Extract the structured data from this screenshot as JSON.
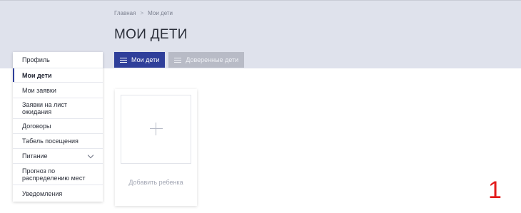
{
  "breadcrumb": {
    "home": "Главная",
    "separator": ">",
    "current": "Мои дети"
  },
  "page": {
    "title": "МОИ ДЕТИ"
  },
  "tabs": [
    {
      "label": "Мои дети",
      "active": true
    },
    {
      "label": "Доверенные дети",
      "active": false
    }
  ],
  "sidebar": {
    "items": [
      {
        "label": "Профиль"
      },
      {
        "label": "Мои дети",
        "active": true
      },
      {
        "label": "Мои заявки"
      },
      {
        "label": "Заявки на лист ожидания"
      },
      {
        "label": "Договоры"
      },
      {
        "label": "Табель посещения"
      },
      {
        "label": "Питание",
        "has_submenu": true
      },
      {
        "label": "Прогноз по распределению мест"
      },
      {
        "label": "Уведомления"
      }
    ]
  },
  "add_child": {
    "label": "Добавить ребенка"
  },
  "annotation": {
    "number": "1"
  },
  "colors": {
    "accent": "#2f3f9a",
    "header_bg": "#dfe2ec",
    "annotation": "#e21b1b"
  }
}
